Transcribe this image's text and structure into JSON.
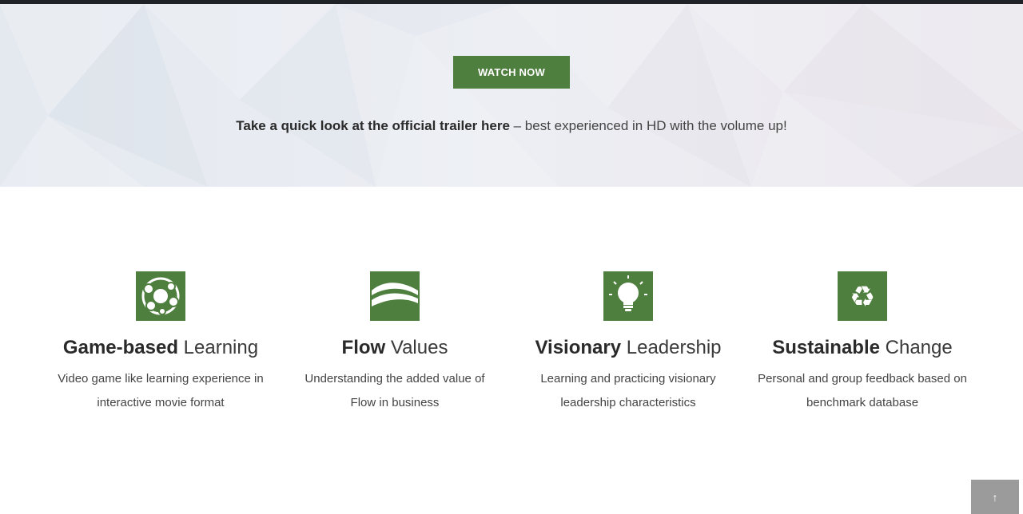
{
  "hero": {
    "button_label": "WATCH NOW",
    "trailer_strong": "Take a quick look at the official trailer here",
    "trailer_rest": " – best experienced in HD with the volume up!"
  },
  "features": [
    {
      "icon": "network-circles-icon",
      "title_bold": "Game-based",
      "title_normal": " Learning",
      "desc_line1": "Video game like learning experience in",
      "desc_line2": "interactive movie format"
    },
    {
      "icon": "flow-wave-icon",
      "title_bold": "Flow",
      "title_normal": " Values",
      "desc_line1": "Understanding the added value of",
      "desc_line2": "Flow in business"
    },
    {
      "icon": "lightbulb-icon",
      "title_bold": "Visionary",
      "title_normal": " Leadership",
      "desc_line1": "Learning and practicing visionary",
      "desc_line2": "leadership characteristics"
    },
    {
      "icon": "recycle-icon",
      "title_bold": "Sustainable",
      "title_normal": " Change",
      "desc_line1": "Personal and group feedback based on",
      "desc_line2": "benchmark database"
    }
  ],
  "scroll_top": {
    "icon": "arrow-up-icon",
    "glyph": "↑"
  },
  "colors": {
    "accent_green": "#4f7f3f",
    "top_strip": "#1f2328",
    "scroll_button": "#9b9b9b"
  }
}
